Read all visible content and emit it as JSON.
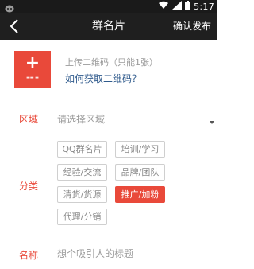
{
  "status_bar": {
    "time": "5:17",
    "icons": [
      "notification-icon",
      "wifi-icon",
      "signal-icon",
      "battery-icon"
    ]
  },
  "nav": {
    "title": "群名片",
    "action": "确认发布"
  },
  "upload": {
    "hint": "上传二维码（只能1张）",
    "link": "如何获取二维码？"
  },
  "region": {
    "label": "区域",
    "placeholder": "请选择区域"
  },
  "category": {
    "label": "分类",
    "options": [
      {
        "label": "QQ群名片",
        "selected": false
      },
      {
        "label": "培训/学习",
        "selected": false
      },
      {
        "label": "经验/交流",
        "selected": false
      },
      {
        "label": "品牌/团队",
        "selected": false
      },
      {
        "label": "清货/货源",
        "selected": false
      },
      {
        "label": "推广/加粉",
        "selected": true
      },
      {
        "label": "代理/分销",
        "selected": false
      }
    ]
  },
  "name": {
    "label": "名称",
    "placeholder": "想个吸引人的标题"
  },
  "colors": {
    "accent": "#e9493a",
    "link": "#2f5a8c",
    "topbar": "#1f1f1f"
  }
}
